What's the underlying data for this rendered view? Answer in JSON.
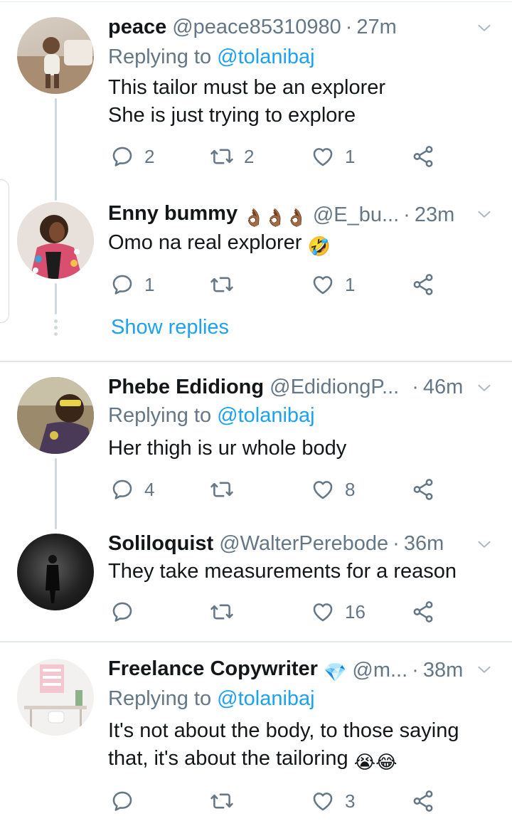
{
  "colors": {
    "accent": "#1da1f2",
    "secondary_text": "#657786",
    "primary_text": "#14171a",
    "divider": "#e6ecf0"
  },
  "tweets": [
    {
      "name": "peace",
      "handle": "@peace85310980",
      "time": "27m",
      "replying_prefix": "Replying to ",
      "replying_to": "@tolanibaj",
      "lines": [
        "This tailor must be an explorer",
        "She is just trying to explore"
      ],
      "reply_count": "2",
      "retweet_count": "2",
      "like_count": "1"
    },
    {
      "name": "Enny bummy",
      "name_emoji": "👌🏾👌🏾👌🏾",
      "handle": "@E_bu...",
      "time": "23m",
      "lines": [
        "Omo na real explorer"
      ],
      "line_emoji": "🤣",
      "reply_count": "1",
      "retweet_count": "",
      "like_count": "1",
      "show_replies": "Show replies"
    },
    {
      "name": "Phebe Edidiong",
      "handle": "@EdidiongP...",
      "time": "46m",
      "replying_prefix": "Replying to ",
      "replying_to": "@tolanibaj",
      "lines": [
        "Her thigh is ur whole body"
      ],
      "reply_count": "4",
      "retweet_count": "",
      "like_count": "8"
    },
    {
      "name": "Soliloquist",
      "handle": "@WalterPerebode",
      "time": "36m",
      "lines": [
        "They take measurements for a reason"
      ],
      "reply_count": "",
      "retweet_count": "",
      "like_count": "16"
    },
    {
      "name": "Freelance Copywriter",
      "name_emoji": "💎",
      "handle": "@m...",
      "time": "38m",
      "replying_prefix": "Replying to ",
      "replying_to": "@tolanibaj",
      "lines": [
        "It's not about the body, to those saying",
        "that, it's about the tailoring"
      ],
      "line_emoji": "😭😂",
      "reply_count": "",
      "retweet_count": "",
      "like_count": "3"
    }
  ],
  "icons": {
    "reply": "reply-icon",
    "retweet": "retweet-icon",
    "like": "heart-icon",
    "share": "share-icon",
    "menu": "chevron-down-icon"
  }
}
